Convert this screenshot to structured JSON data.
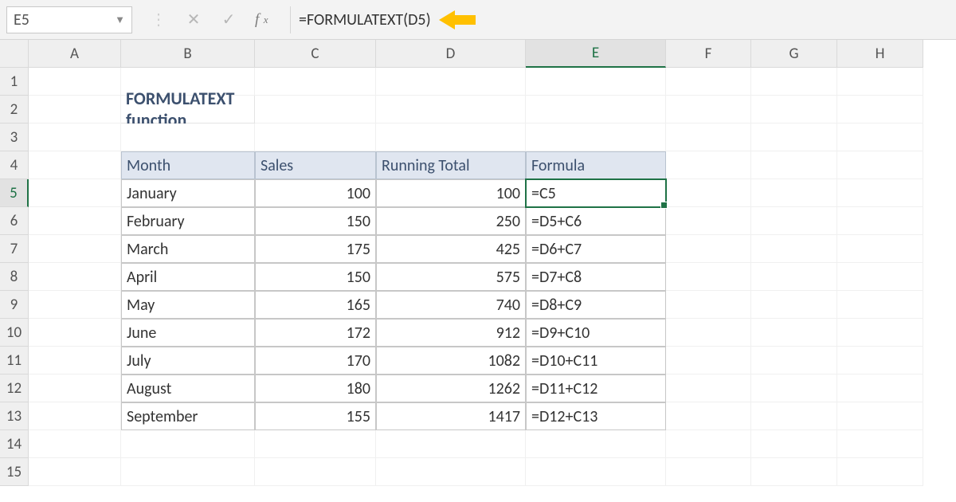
{
  "name_box": "E5",
  "formula_bar": "=FORMULATEXT(D5)",
  "columns": [
    "A",
    "B",
    "C",
    "D",
    "E",
    "F",
    "G",
    "H"
  ],
  "rows": [
    "1",
    "2",
    "3",
    "4",
    "5",
    "6",
    "7",
    "8",
    "9",
    "10",
    "11",
    "12",
    "13",
    "14",
    "15"
  ],
  "title": "FORMULATEXT function",
  "headers": {
    "month": "Month",
    "sales": "Sales",
    "running": "Running Total",
    "formula": "Formula"
  },
  "data": [
    {
      "month": "January",
      "sales": "100",
      "running": "100",
      "formula": "=C5"
    },
    {
      "month": "February",
      "sales": "150",
      "running": "250",
      "formula": "=D5+C6"
    },
    {
      "month": "March",
      "sales": "175",
      "running": "425",
      "formula": "=D6+C7"
    },
    {
      "month": "April",
      "sales": "150",
      "running": "575",
      "formula": "=D7+C8"
    },
    {
      "month": "May",
      "sales": "165",
      "running": "740",
      "formula": "=D8+C9"
    },
    {
      "month": "June",
      "sales": "172",
      "running": "912",
      "formula": "=D9+C10"
    },
    {
      "month": "July",
      "sales": "170",
      "running": "1082",
      "formula": "=D10+C11"
    },
    {
      "month": "August",
      "sales": "180",
      "running": "1262",
      "formula": "=D11+C12"
    },
    {
      "month": "September",
      "sales": "155",
      "running": "1417",
      "formula": "=D12+C13"
    }
  ],
  "selected_col": "E",
  "selected_row": "5"
}
